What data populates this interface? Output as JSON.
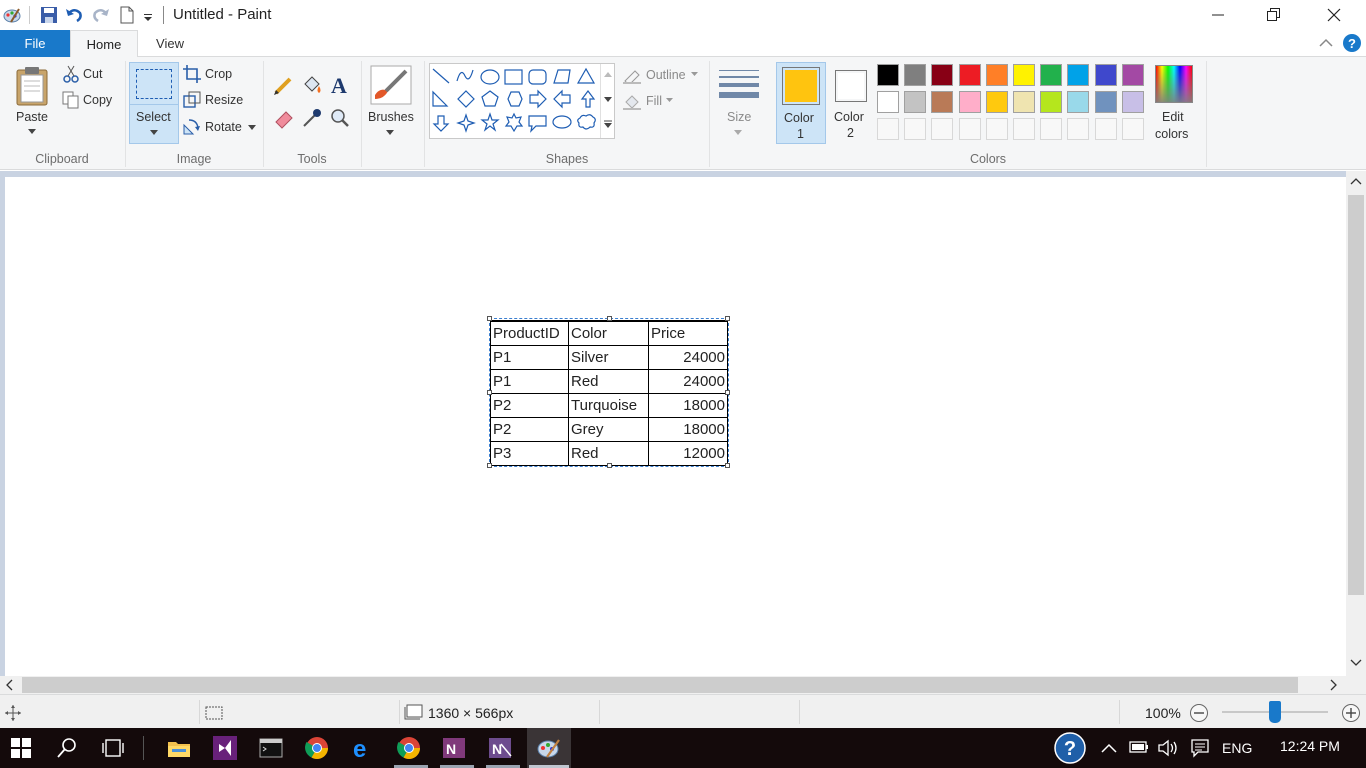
{
  "window": {
    "title": "Untitled - Paint"
  },
  "tabs": {
    "file": "File",
    "home": "Home",
    "view": "View"
  },
  "clipboard": {
    "paste": "Paste",
    "cut": "Cut",
    "copy": "Copy",
    "group": "Clipboard"
  },
  "image": {
    "select": "Select",
    "crop": "Crop",
    "resize": "Resize",
    "rotate": "Rotate",
    "group": "Image"
  },
  "tools": {
    "group": "Tools"
  },
  "brushes": {
    "label": "Brushes"
  },
  "shapes": {
    "outline": "Outline",
    "fill": "Fill",
    "group": "Shapes"
  },
  "size": {
    "label": "Size"
  },
  "colors": {
    "color1_line1": "Color",
    "color1_line2": "1",
    "color2_line1": "Color",
    "color2_line2": "2",
    "edit_line1": "Edit",
    "edit_line2": "colors",
    "group": "Colors",
    "color1_value": "#ffc40f",
    "color2_value": "#ffffff",
    "palette_row1": [
      "#000000",
      "#7f7f7f",
      "#880015",
      "#ed1c24",
      "#ff7f27",
      "#fff200",
      "#22b14c",
      "#00a2e8",
      "#3f48cc",
      "#a349a4"
    ],
    "palette_row2": [
      "#ffffff",
      "#c3c3c3",
      "#b97a57",
      "#ffaec9",
      "#ffc90e",
      "#efe4b0",
      "#b5e61d",
      "#99d9ea",
      "#7092be",
      "#c8bfe7"
    ]
  },
  "table": {
    "headers": [
      "ProductID",
      "Color",
      "Price"
    ],
    "rows": [
      [
        "P1",
        "Silver",
        "24000"
      ],
      [
        "P1",
        "Red",
        "24000"
      ],
      [
        "P2",
        "Turquoise",
        "18000"
      ],
      [
        "P2",
        "Grey",
        "18000"
      ],
      [
        "P3",
        "Red",
        "12000"
      ]
    ]
  },
  "status": {
    "canvas_size": "1360 × 566px",
    "zoom": "100%"
  },
  "taskbar": {
    "language": "ENG",
    "time": "12:24 PM"
  }
}
